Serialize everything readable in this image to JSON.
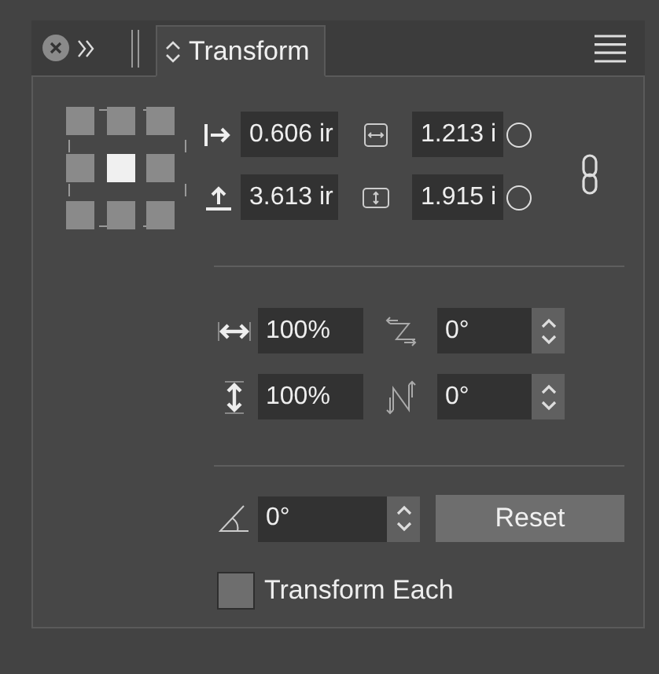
{
  "tab": {
    "label": "Transform",
    "selected": true
  },
  "reference_point": [
    {
      "selected": false
    },
    {
      "selected": false
    },
    {
      "selected": false
    },
    {
      "selected": false
    },
    {
      "selected": true
    },
    {
      "selected": false
    },
    {
      "selected": false
    },
    {
      "selected": false
    },
    {
      "selected": false
    }
  ],
  "position": [
    {
      "kind": "x",
      "value": "0.606 ir"
    },
    {
      "kind": "y",
      "value": "3.613 ir"
    }
  ],
  "size": [
    {
      "kind": "width",
      "value": "1.213 i",
      "selected": false
    },
    {
      "kind": "height",
      "value": "1.915 i",
      "selected": false
    }
  ],
  "constrain_proportions": {
    "on": false
  },
  "scale": [
    {
      "kind": "horizontal",
      "value": "100%"
    },
    {
      "kind": "vertical",
      "value": "100%"
    }
  ],
  "shear": [
    {
      "kind": "horizontal",
      "value": "0°"
    },
    {
      "kind": "vertical",
      "value": "0°"
    }
  ],
  "rotate": {
    "value": "0°"
  },
  "reset_button": "Reset",
  "transform_each": {
    "label": "Transform Each",
    "checked": false
  }
}
